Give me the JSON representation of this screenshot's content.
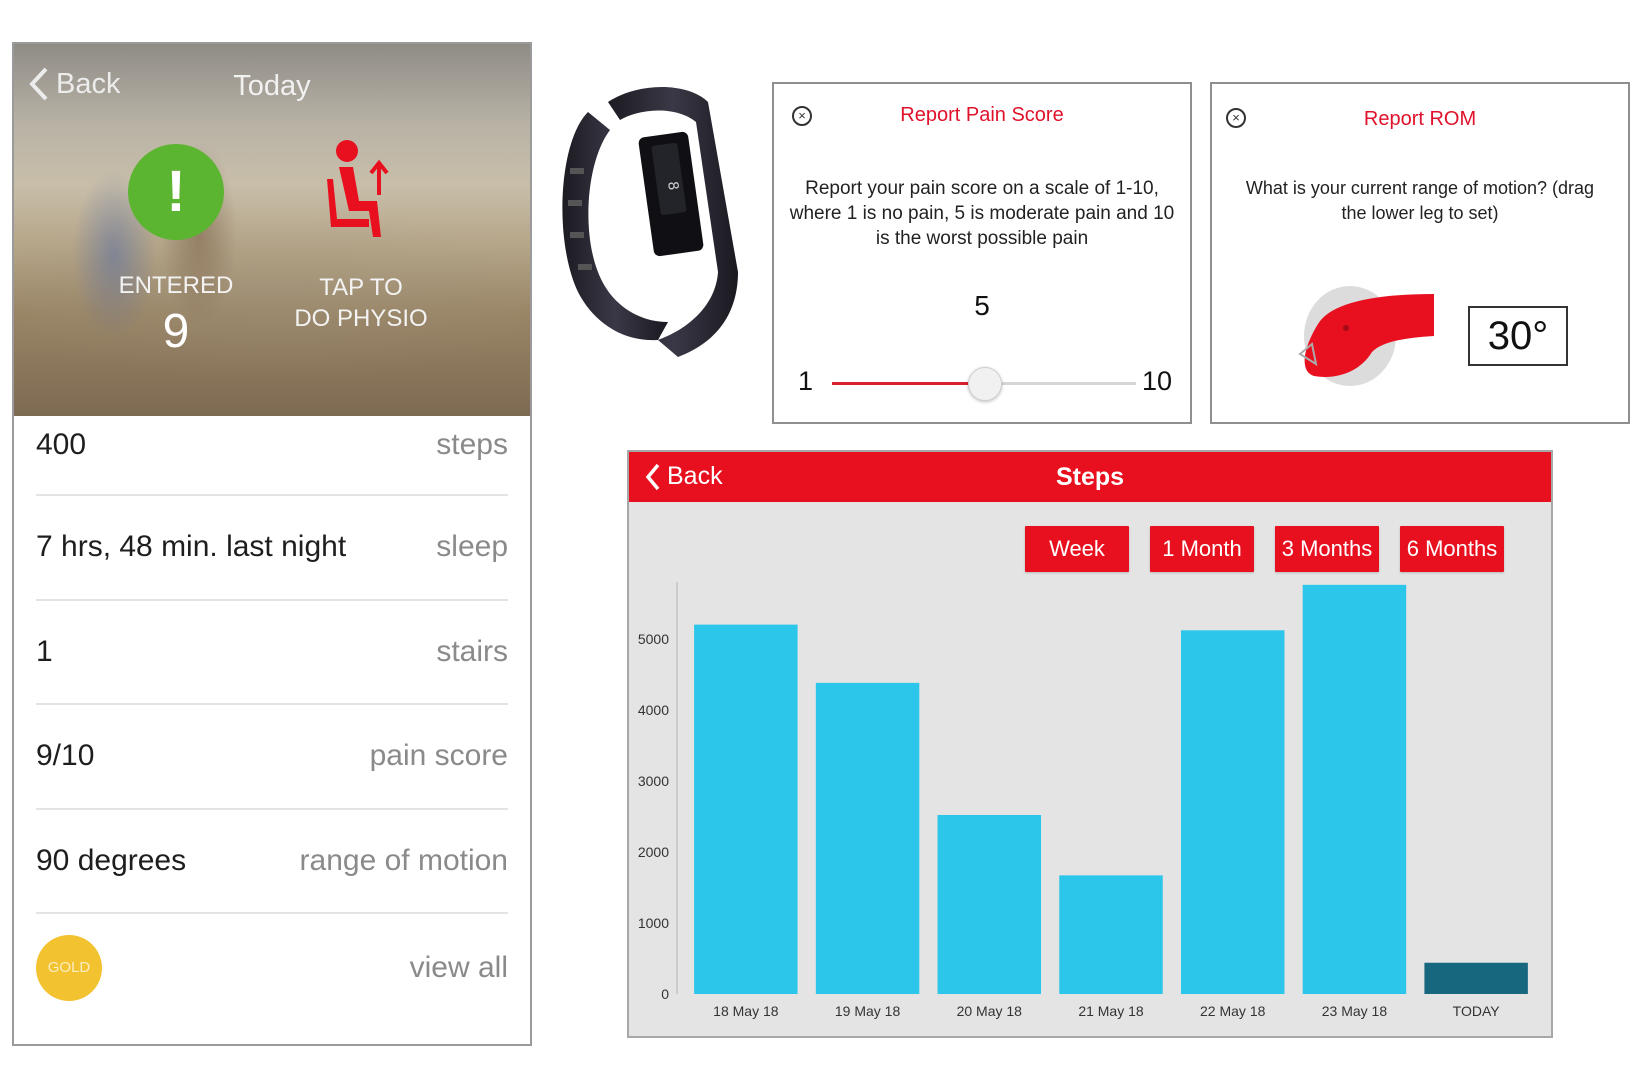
{
  "phone": {
    "back_label": "Back",
    "title": "Today",
    "entered": {
      "icon_glyph": "!",
      "label": "ENTERED",
      "count": "9"
    },
    "physio": {
      "label_line1": "TAP TO",
      "label_line2": "DO PHYSIO"
    },
    "rows": [
      {
        "value": "400",
        "label": "steps"
      },
      {
        "value": "7 hrs, 48 min. last night",
        "label": "sleep"
      },
      {
        "value": "1",
        "label": "stairs"
      },
      {
        "value": "9/10",
        "label": "pain score"
      },
      {
        "value": "90 degrees",
        "label": "range of motion"
      }
    ],
    "badge": "GOLD",
    "view_all": "view all"
  },
  "pain_dialog": {
    "title": "Report Pain Score",
    "text_line1": "Report your pain score on a scale of 1-10,",
    "text_line2": "where 1 is no pain, 5 is moderate pain and 10",
    "text_line3": "is the worst possible pain",
    "value": "5",
    "min_label": "1",
    "max_label": "10",
    "slider_fraction": 0.5
  },
  "rom_dialog": {
    "title": "Report ROM",
    "text_line1": "What is your current range of motion? (drag",
    "text_line2": "the lower leg to set)",
    "value": "30°"
  },
  "steps_panel": {
    "back_label": "Back",
    "title": "Steps",
    "ranges": [
      "Week",
      "1 Month",
      "3 Months",
      "6 Months"
    ]
  },
  "colors": {
    "accent_red": "#e8101f",
    "bar_blue": "#2cc6ea",
    "bar_today": "#17687f",
    "green": "#5cb531",
    "gold": "#f2c230"
  },
  "chart_data": {
    "type": "bar",
    "categories": [
      "18 May 18",
      "19 May 18",
      "20 May 18",
      "21 May 18",
      "22 May 18",
      "23 May 18",
      "TODAY"
    ],
    "values": [
      5200,
      4380,
      2520,
      1670,
      5120,
      5760,
      440
    ],
    "yticks": [
      0,
      1000,
      2000,
      3000,
      4000,
      5000
    ],
    "ylim": [
      0,
      5800
    ],
    "grid": false
  }
}
